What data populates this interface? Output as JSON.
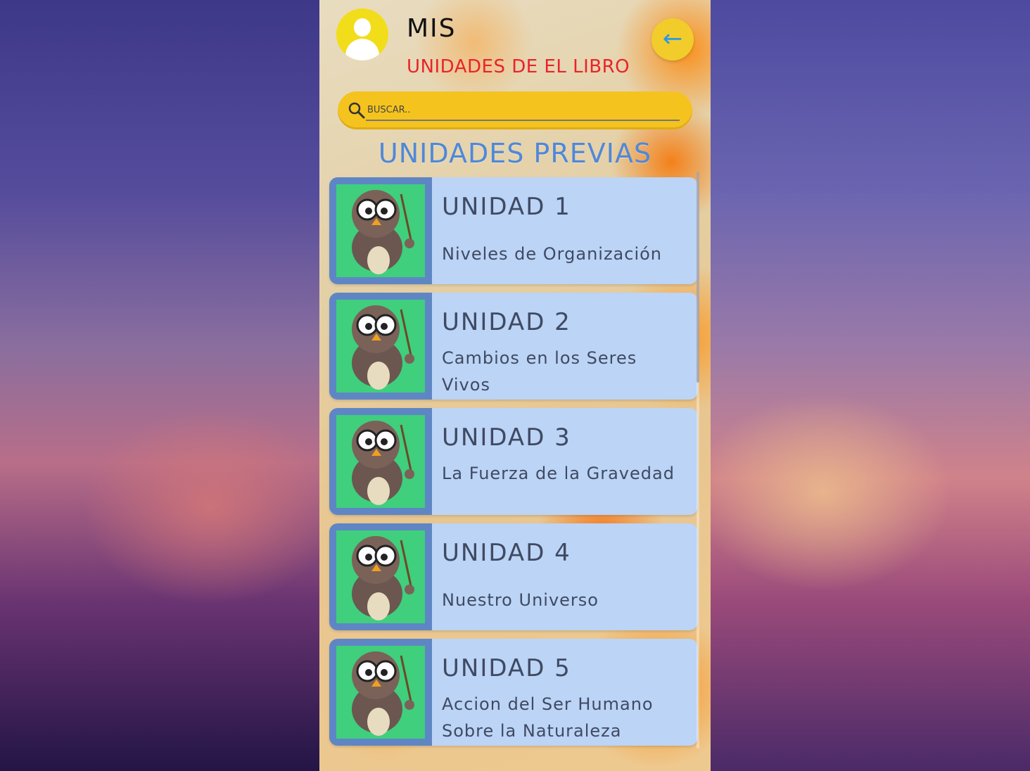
{
  "header": {
    "title": "MIS",
    "subtitle": "UNIDADES DE EL LIBRO",
    "back_icon": "arrow-left-icon"
  },
  "search": {
    "placeholder": "BUSCAR..",
    "icon": "search-icon"
  },
  "section": {
    "heading": "UNIDADES PREVIAS"
  },
  "units": [
    {
      "title": "UNIDAD 1",
      "description": "Niveles de Organización"
    },
    {
      "title": "UNIDAD 2",
      "description": "Cambios en los Seres Vivos"
    },
    {
      "title": "UNIDAD 3",
      "description": "La Fuerza de la Gravedad"
    },
    {
      "title": "UNIDAD 4",
      "description": "Nuestro Universo"
    },
    {
      "title": "UNIDAD 5",
      "description": "Accion del Ser Humano Sobre la Naturaleza"
    }
  ],
  "colors": {
    "avatar": "#f2dd1a",
    "subtitle": "#e8242a",
    "search_bar": "#f5c31e",
    "heading": "#4f88d8",
    "card": "#bcd4f5",
    "thumb_bg": "#3fcf7d",
    "thumb_frame": "#5f86c4"
  }
}
